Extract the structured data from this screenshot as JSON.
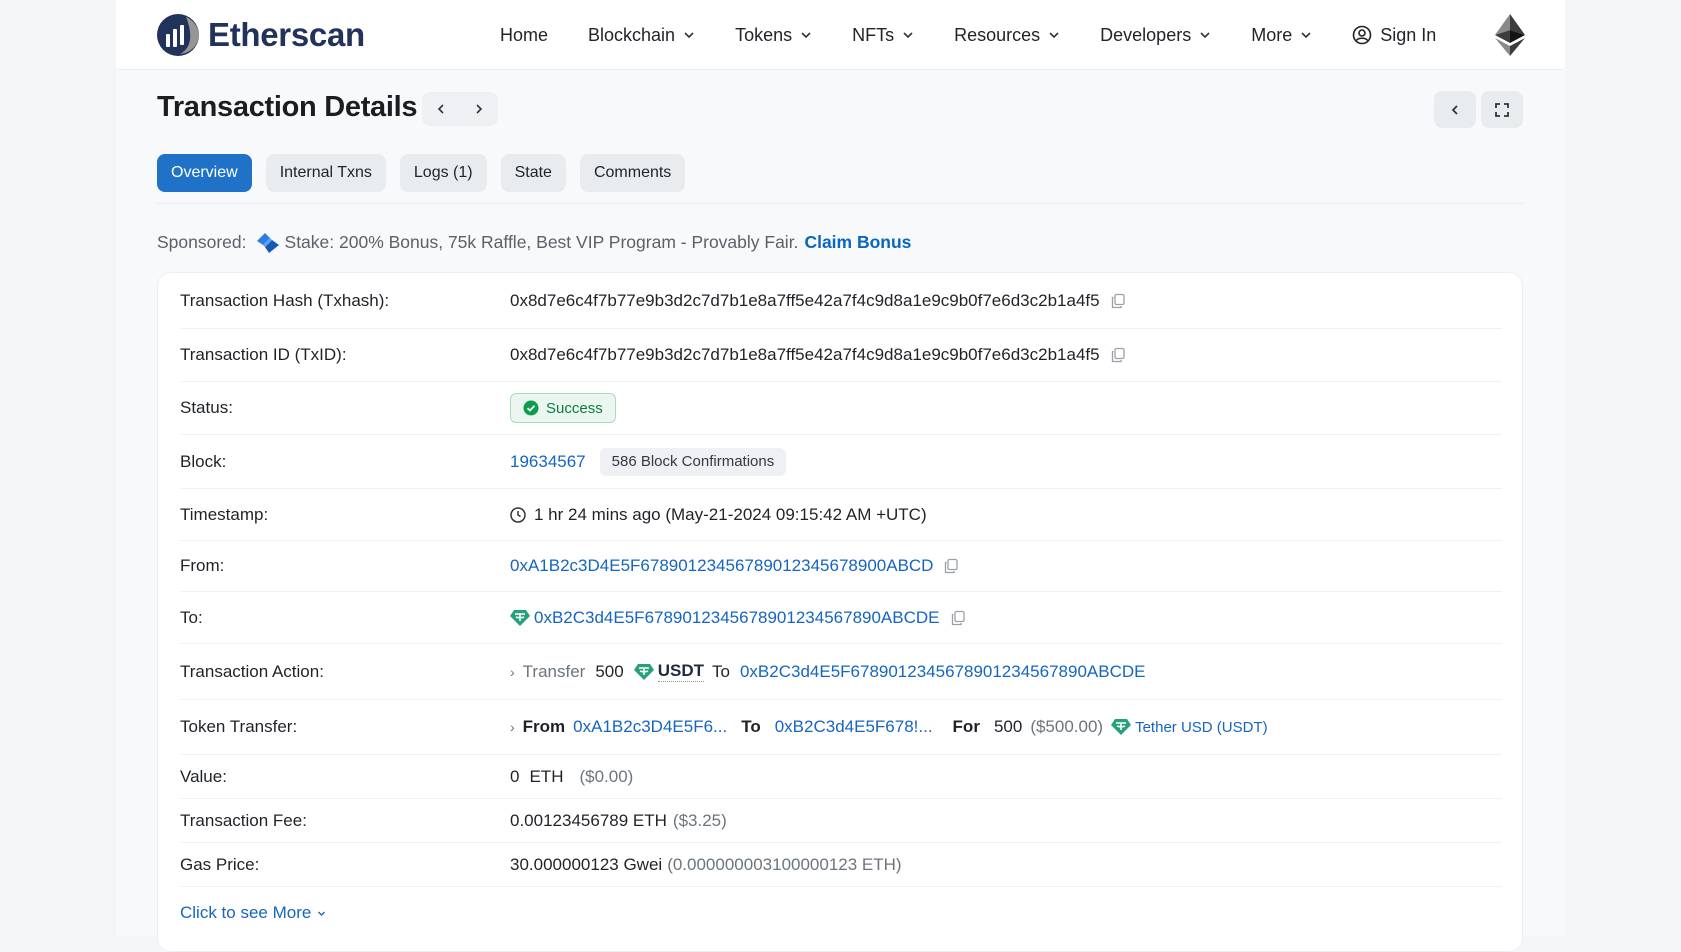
{
  "brand": {
    "name": "Etherscan",
    "primary": "#21325b",
    "accent": "#1f72c8"
  },
  "nav": {
    "items": [
      {
        "label": "Home",
        "dropdown": false
      },
      {
        "label": "Blockchain",
        "dropdown": true
      },
      {
        "label": "Tokens",
        "dropdown": true
      },
      {
        "label": "NFTs",
        "dropdown": true
      },
      {
        "label": "Resources",
        "dropdown": true
      },
      {
        "label": "Developers",
        "dropdown": true
      },
      {
        "label": "More",
        "dropdown": true
      }
    ],
    "sign_in": "Sign In"
  },
  "page": {
    "title": "Transaction Details"
  },
  "tabs": [
    {
      "label": "Overview",
      "active": true
    },
    {
      "label": "Internal Txns",
      "active": false
    },
    {
      "label": "Logs (1)",
      "active": false
    },
    {
      "label": "State",
      "active": false
    },
    {
      "label": "Comments",
      "active": false
    }
  ],
  "sponsored": {
    "label": "Sponsored:",
    "text": "Stake: 200% Bonus, 75k Raffle, Best VIP Program - Provably Fair.",
    "link": "Claim Bonus"
  },
  "details": {
    "tx_hash": {
      "label": "Transaction Hash (Txhash):",
      "value": "0x8d7e6c4f7b77e9b3d2c7d7b1e8a7ff5e42a7f4c9d8a1e9c9b0f7e6d3c2b1a4f5"
    },
    "tx_id": {
      "label": "Transaction ID (TxID):",
      "value": "0x8d7e6c4f7b77e9b3d2c7d7b1e8a7ff5e42a7f4c9d8a1e9c9b0f7e6d3c2b1a4f5"
    },
    "status": {
      "label": "Status:",
      "value": "Success"
    },
    "block": {
      "label": "Block:",
      "value": "19634567",
      "confirmations": "586 Block Confirmations"
    },
    "timestamp": {
      "label": "Timestamp:",
      "value": "1 hr 24 mins ago (May-21-2024 09:15:42 AM +UTC)"
    },
    "from": {
      "label": "From:",
      "value": "0xA1B2c3D4E5F67890123456789012345678900ABCD"
    },
    "to": {
      "label": "To:",
      "value": "0xB2C3d4E5F6789012345678901234567890ABCDE"
    },
    "action": {
      "label": "Transaction Action:",
      "verb": "Transfer",
      "amount": "500",
      "token": "USDT",
      "to_word": "To",
      "to_addr": "0xB2C3d4E5F6789012345678901234567890ABCDE"
    },
    "token_transfer": {
      "label": "Token Transfer:",
      "from_word": "From",
      "from_addr": "0xA1B2c3D4E5F6...",
      "to_word": "To",
      "to_addr": "0xB2C3d4E5F678!...",
      "for_word": "For",
      "amount": "500",
      "usd": "($500.00)",
      "token_name": "Tether USD (USDT)"
    },
    "value": {
      "label": "Value:",
      "amount": "0",
      "unit": "ETH",
      "usd": "($0.00)"
    },
    "fee": {
      "label": "Transaction Fee:",
      "value": "0.00123456789 ETH",
      "usd": "($3.25)"
    },
    "gas_price": {
      "label": "Gas Price:",
      "value": "30.000000123 Gwei",
      "eth": "(0.000000003100000123 ETH)"
    }
  },
  "more_link": "Click to see More"
}
